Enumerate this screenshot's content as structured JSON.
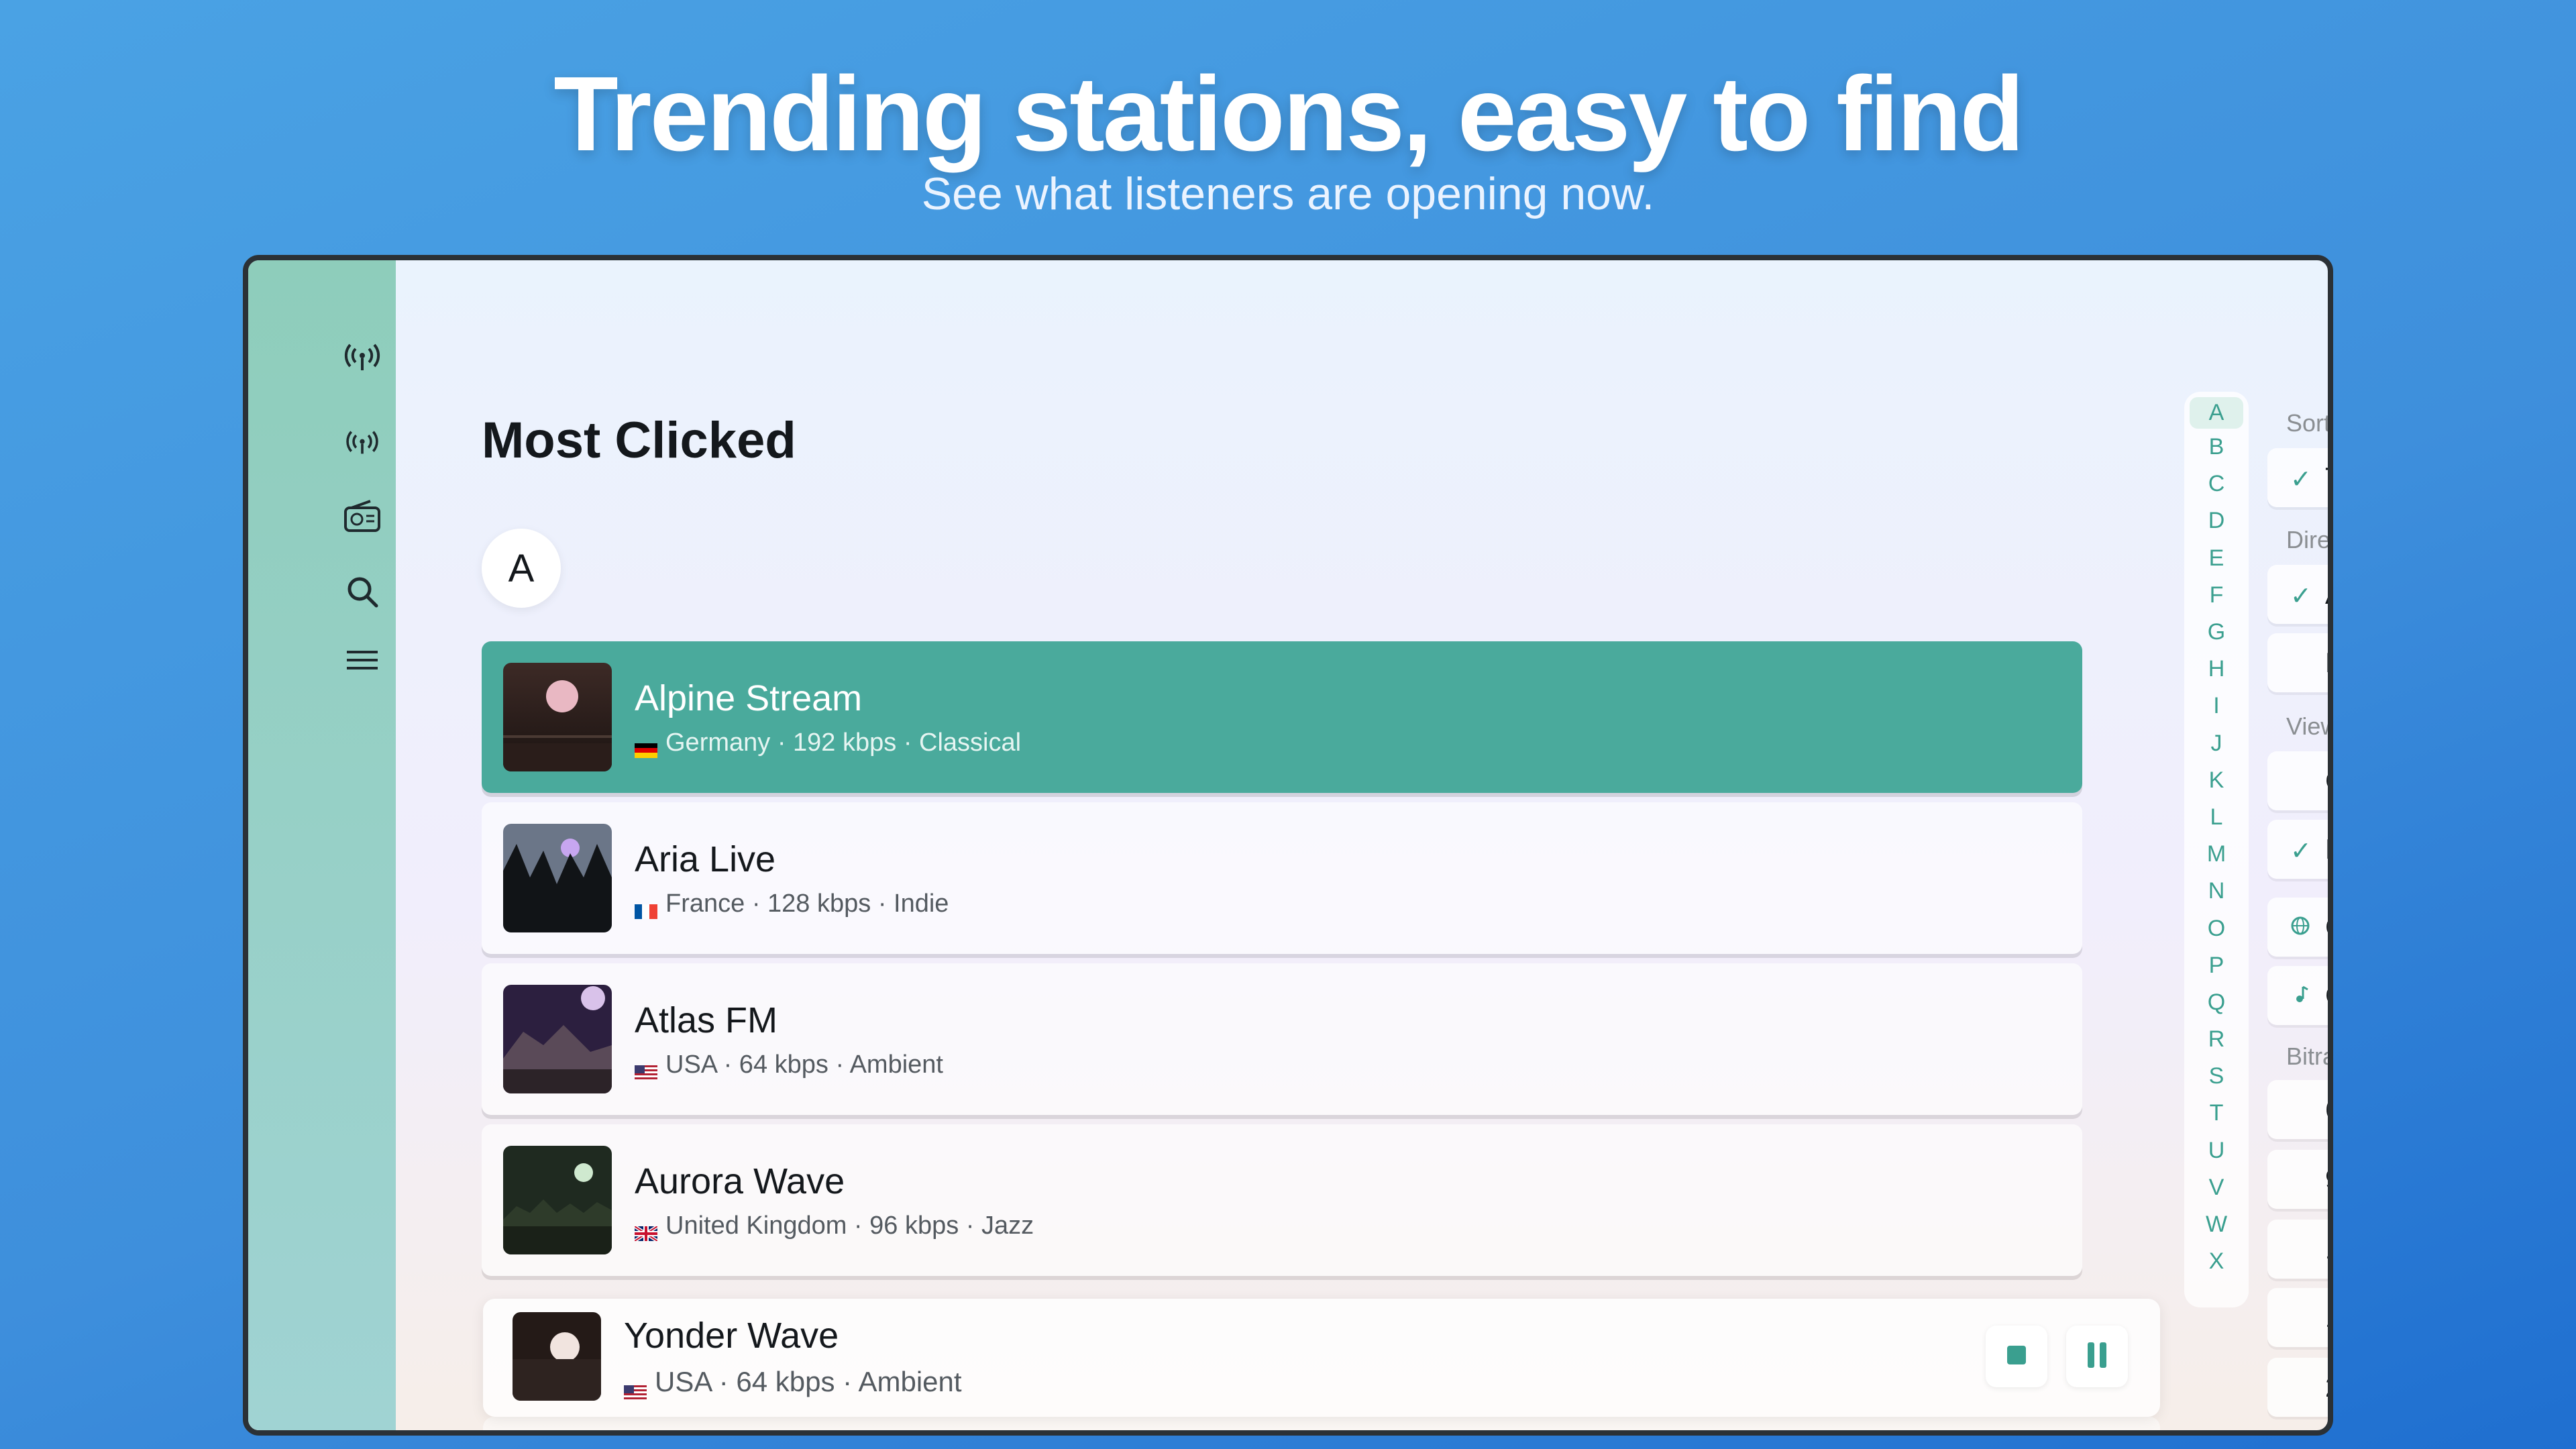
{
  "marketing": {
    "headline": "Trending stations, easy to find",
    "subheadline": "See what listeners are opening now."
  },
  "sidebar": {
    "items": [
      {
        "icon": "broadcast-icon"
      },
      {
        "icon": "antenna-icon"
      },
      {
        "icon": "radio-icon"
      },
      {
        "icon": "search-icon"
      },
      {
        "icon": "menu-icon"
      }
    ]
  },
  "main": {
    "title": "Most Clicked",
    "section": "A",
    "stations": [
      {
        "name": "Alpine Stream",
        "meta": "Germany · 192 kbps · Classical",
        "flag": "germany-flag",
        "selected": true
      },
      {
        "name": "Aria Live",
        "meta": "France · 128 kbps · Indie",
        "flag": "france-flag",
        "selected": false
      },
      {
        "name": "Atlas FM",
        "meta": "USA · 64 kbps · Ambient",
        "flag": "usa-flag",
        "selected": false
      },
      {
        "name": "Aurora Wave",
        "meta": "United Kingdom · 96 kbps · Jazz",
        "flag": "uk-flag",
        "selected": false
      }
    ]
  },
  "alphabet_index": [
    "A",
    "B",
    "C",
    "D",
    "E",
    "F",
    "G",
    "H",
    "I",
    "J",
    "K",
    "L",
    "M",
    "N",
    "O",
    "P",
    "Q",
    "R",
    "S",
    "T",
    "U",
    "V",
    "W",
    "X"
  ],
  "filter_panel": {
    "labels": [
      "Sort",
      "Dire",
      "View",
      "Bitra"
    ],
    "sort_items": [
      {
        "check": "✓",
        "text": "T"
      }
    ],
    "direction_items": [
      {
        "check": "✓",
        "text": "A"
      },
      {
        "check": "",
        "text": "D"
      }
    ],
    "view_items": [
      {
        "check": "",
        "text": "G"
      },
      {
        "check": "✓",
        "text": "L"
      },
      {
        "check": "globe-icon",
        "text": "C"
      },
      {
        "check": "music-note-icon",
        "text": "G"
      }
    ],
    "bitrate_items": [
      {
        "text": "6"
      },
      {
        "text": "9"
      },
      {
        "text": "1"
      },
      {
        "text": "1"
      },
      {
        "text": "2"
      }
    ]
  },
  "player": {
    "name": "Yonder Wave",
    "meta": "USA · 64 kbps · Ambient",
    "flag": "usa-flag",
    "stop_icon": "stop-icon",
    "pause_icon": "pause-icon"
  },
  "colors": {
    "accent": "#3a9f8f",
    "selected_row": "#4aaa9c",
    "sidebar": "#8ecdbb",
    "background": "#3e8fdc"
  }
}
